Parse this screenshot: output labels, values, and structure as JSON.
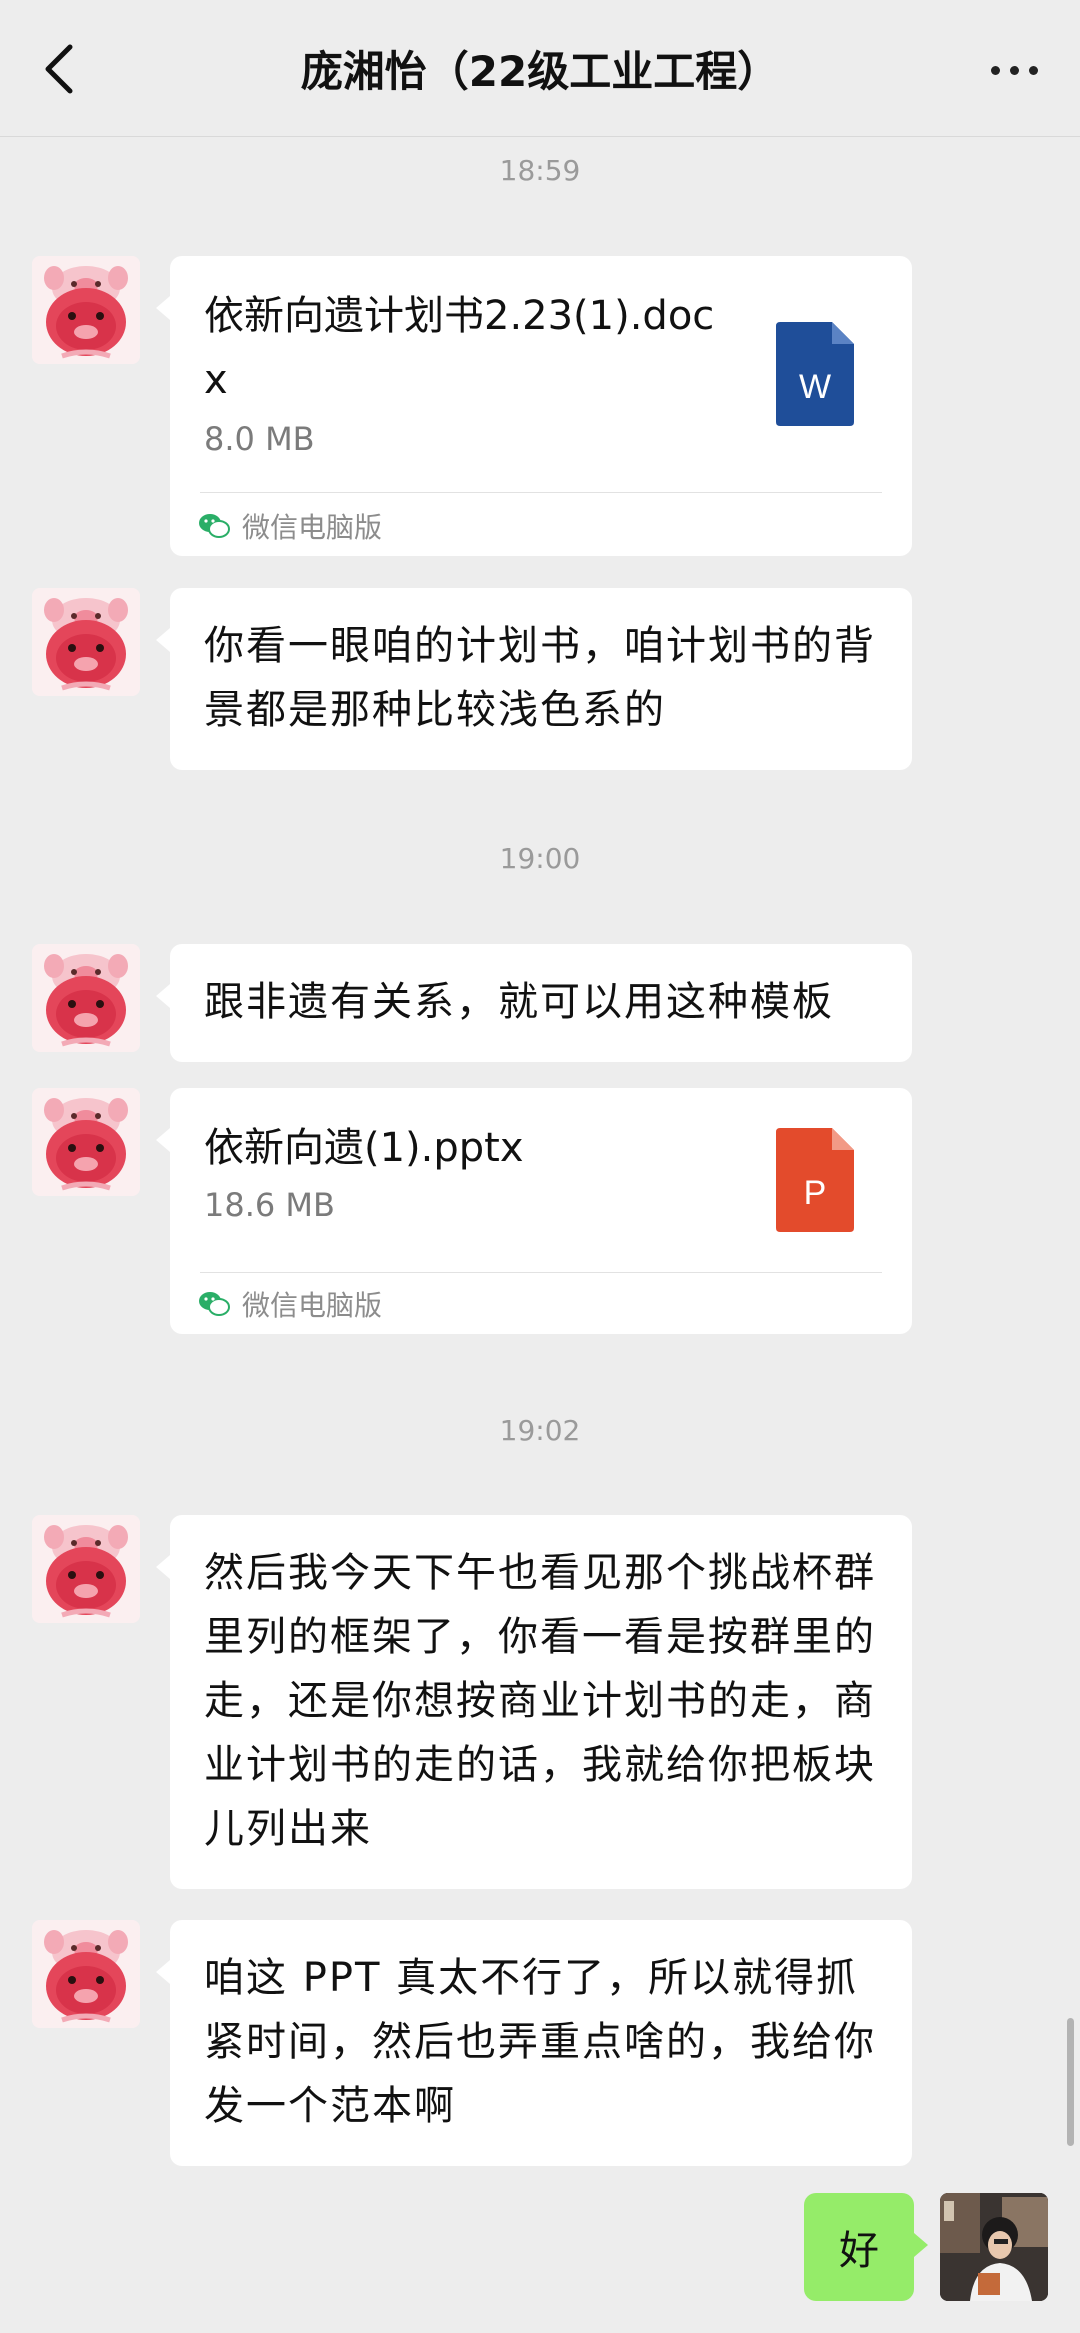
{
  "header": {
    "title": "庞湘怡（22级工业工程）"
  },
  "timestamps": [
    "18:59",
    "19:00",
    "19:02"
  ],
  "messages": {
    "file1": {
      "name": "依新向遗计划书2.23(1).docx",
      "size": "8.0 MB",
      "source": "微信电脑版",
      "icon_letter": "W",
      "icon_color": "#1f4e99"
    },
    "text1": "你看一眼咱的计划书，咱计划书的背景都是那种比较浅色系的",
    "text2": "跟非遗有关系，就可以用这种模板",
    "file2": {
      "name": "依新向遗(1).pptx",
      "size": "18.6 MB",
      "source": "微信电脑版",
      "icon_letter": "P",
      "icon_color": "#e34b2c"
    },
    "text3": "然后我今天下午也看见那个挑战杯群里列的框架了，你看一看是按群里的走，还是你想按商业计划书的走，商业计划书的走的话，我就给你把板块儿列出来",
    "text4": "咱这 PPT 真太不行了，所以就得抓紧时间，然后也弄重点啥的，我给你发一个范本啊",
    "me_text": "好"
  },
  "colors": {
    "background": "#ededed",
    "me_bubble": "#95ec69",
    "bubble": "#ffffff"
  }
}
